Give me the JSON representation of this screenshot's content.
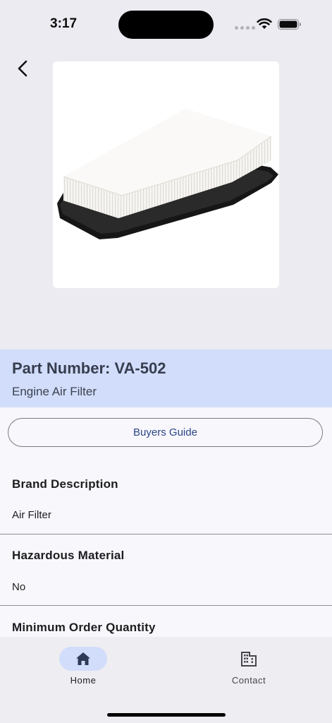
{
  "status_bar": {
    "time": "3:17"
  },
  "navigation": {
    "back_icon": "chevron-left-icon"
  },
  "product": {
    "image_description_icon": "engine-air-filter-image",
    "part_number": "Part Number: VA-502",
    "subtitle": "Engine Air Filter"
  },
  "actions": {
    "buyers_guide_label": "Buyers Guide"
  },
  "details": [
    {
      "label": "Brand Description",
      "value": "Air Filter"
    },
    {
      "label": "Hazardous Material",
      "value": "No"
    },
    {
      "label": "Minimum Order Quantity",
      "value": ""
    }
  ],
  "tab_bar": {
    "tabs": [
      {
        "label": "Home",
        "icon": "home-icon",
        "selected": true
      },
      {
        "label": "Contact",
        "icon": "building-icon",
        "selected": false
      }
    ]
  },
  "colors": {
    "header_band": "#d1ddfa",
    "accent_text": "#2a4584",
    "selected_tab_pill": "#d1ddfa"
  }
}
